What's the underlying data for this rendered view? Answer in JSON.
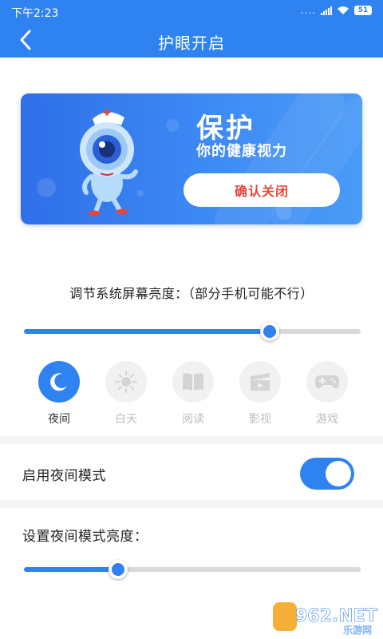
{
  "status_bar": {
    "time": "下午2:23",
    "signal_dots": "....",
    "battery": "51"
  },
  "header": {
    "title": "护眼开启"
  },
  "banner": {
    "headline": "保护",
    "subline": "你的健康视力",
    "button_label": "确认关闭"
  },
  "brightness": {
    "label": "调节系统屏幕亮度：（部分手机可能不行）",
    "value_fraction": 0.73
  },
  "modes": [
    {
      "label": "夜间",
      "icon": "moon-icon",
      "active": true
    },
    {
      "label": "白天",
      "icon": "sun-icon",
      "active": false
    },
    {
      "label": "阅读",
      "icon": "book-icon",
      "active": false
    },
    {
      "label": "影视",
      "icon": "film-icon",
      "active": false
    },
    {
      "label": "游戏",
      "icon": "gamepad-icon",
      "active": false
    }
  ],
  "night_mode": {
    "label": "启用夜间模式",
    "enabled": true
  },
  "night_brightness": {
    "label": "设置夜间模式亮度：",
    "value_fraction": 0.28
  },
  "watermark": {
    "brand": "962.NET",
    "sub": "乐游网"
  },
  "colors": {
    "accent": "#2f83f0",
    "banner_button_text": "#e4473a",
    "inactive": "#bdbdbd"
  }
}
